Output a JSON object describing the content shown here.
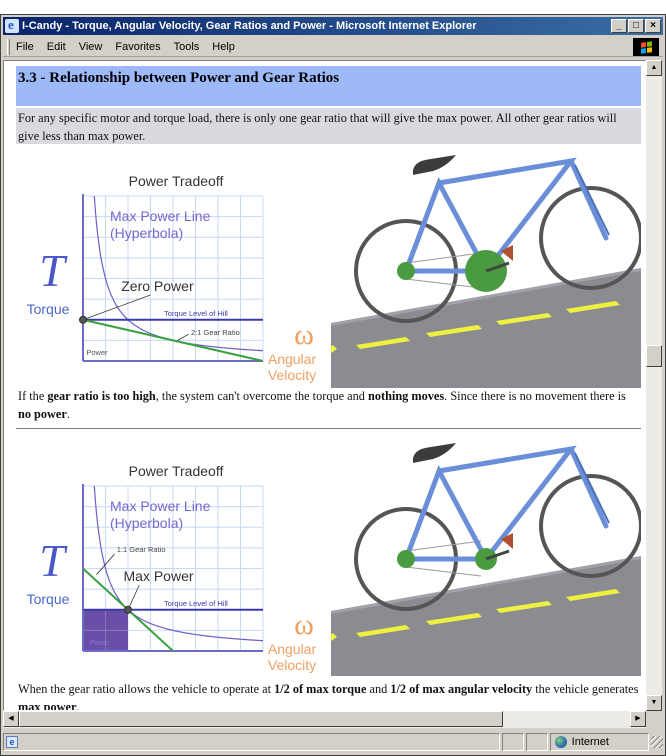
{
  "window": {
    "title": "I-Candy - Torque, Angular Velocity, Gear Ratios and Power - Microsoft Internet Explorer",
    "controls": {
      "minimize": "_",
      "maximize": "□",
      "close": "×"
    }
  },
  "menubar": {
    "items": [
      {
        "label": "File"
      },
      {
        "label": "Edit"
      },
      {
        "label": "View"
      },
      {
        "label": "Favorites"
      },
      {
        "label": "Tools"
      },
      {
        "label": "Help"
      }
    ]
  },
  "page": {
    "section_title": "3.3 - Relationship between Power and Gear Ratios",
    "intro": "For any specific motor and torque load, there is only one gear ratio that will give the max power. All other gear ratios will give less than max power.",
    "para1": {
      "p1": "If the ",
      "b1": "gear ratio is too high",
      "p2": ", the system can't overcome the torque and ",
      "b2": "nothing moves",
      "p3": ". Since there is no movement there is ",
      "b3": "no power",
      "p4": "."
    },
    "para2": {
      "p1": "When the gear ratio allows the vehicle to operate at ",
      "b1": "1/2 of max torque",
      "p2": " and ",
      "b2": "1/2 of max angular velocity",
      "p3": " the vehicle generates ",
      "b3": "max power",
      "p4": "."
    }
  },
  "chart_data": [
    {
      "type": "line",
      "title": "Power Tradeoff",
      "ylabel_symbol": "T",
      "ylabel": "Torque",
      "xlabel_symbol": "ω",
      "xlabel": "Angular Velocity",
      "grid": true,
      "xlim": [
        0,
        8
      ],
      "ylim": [
        0,
        8
      ],
      "annotations": {
        "hyperbola": "Max Power Line (Hyperbola)",
        "point": "Zero Power",
        "hill": "Torque Level of Hill",
        "gear": "2:1 Gear Ratio",
        "power": "Power"
      },
      "hill_torque": 2,
      "hyperbola_k": 4,
      "gear_line": {
        "t0": 2,
        "slope": -0.25
      },
      "operating_point": [
        0,
        2
      ],
      "power_area": [
        0,
        0
      ]
    },
    {
      "type": "line",
      "title": "Power Tradeoff",
      "ylabel_symbol": "T",
      "ylabel": "Torque",
      "xlabel_symbol": "ω",
      "xlabel": "Angular Velocity",
      "grid": true,
      "xlim": [
        0,
        8
      ],
      "ylim": [
        0,
        8
      ],
      "annotations": {
        "hyperbola": "Max Power Line (Hyperbola)",
        "point": "Max Power",
        "hill": "Torque Level of Hill",
        "gear": "1:1 Gear Ratio",
        "power": "Power"
      },
      "hill_torque": 2,
      "hyperbola_k": 4,
      "gear_line": {
        "t0": 4,
        "slope": -1
      },
      "operating_point": [
        2,
        2
      ],
      "power_area": [
        2,
        2
      ]
    }
  ],
  "scrollbars": {
    "up": "▲",
    "down": "▼",
    "left": "◀",
    "right": "▶",
    "vertical_position": 0.45
  },
  "statusbar": {
    "zone": "Internet"
  }
}
